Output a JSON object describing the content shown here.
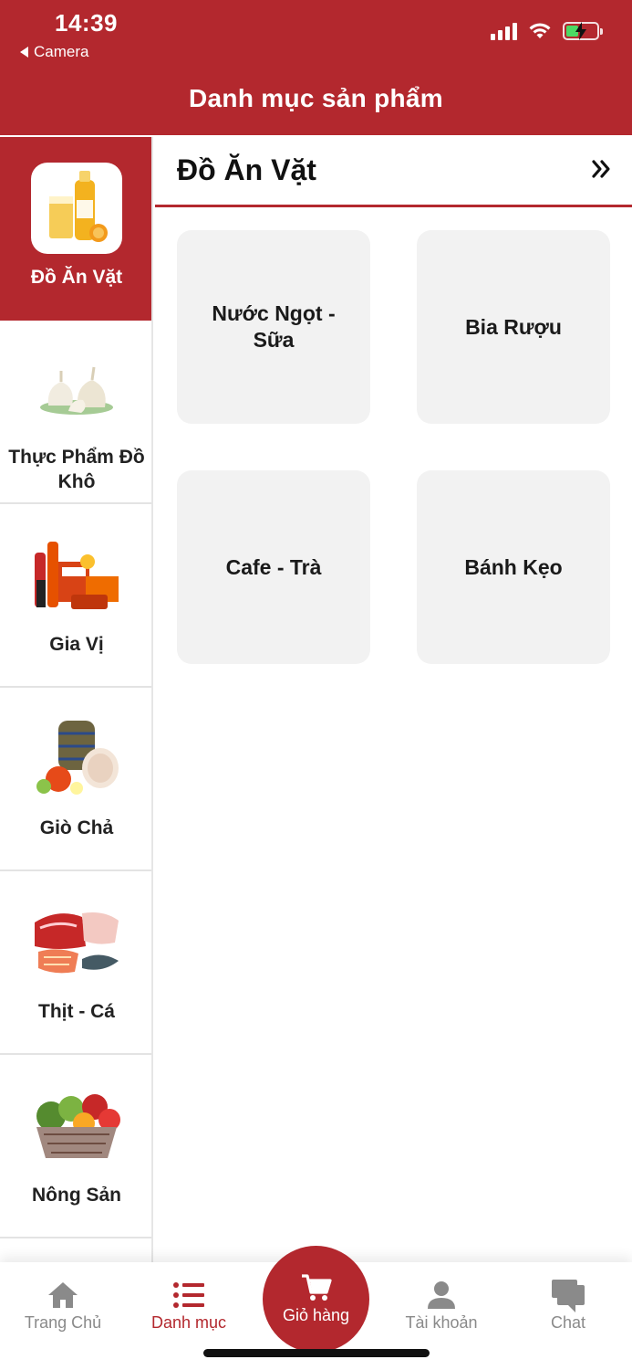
{
  "status_bar": {
    "time": "14:39",
    "back_label": "Camera"
  },
  "header": {
    "title": "Danh mục sản phẩm"
  },
  "sidebar": {
    "items": [
      {
        "label": "Đồ Ăn Vặt",
        "active": true,
        "icon": "juice-bottle-image"
      },
      {
        "label": "Thực Phẩm Đồ Khô",
        "active": false,
        "icon": "garlic-image"
      },
      {
        "label": "Gia Vị",
        "active": false,
        "icon": "spices-image"
      },
      {
        "label": "Giò Chả",
        "active": false,
        "icon": "pork-roll-image"
      },
      {
        "label": "Thịt - Cá",
        "active": false,
        "icon": "meat-fish-image"
      },
      {
        "label": "Nông Sản",
        "active": false,
        "icon": "vegetables-basket-image"
      }
    ]
  },
  "main": {
    "section_title": "Đồ Ăn Vặt",
    "more_icon": "double-chevron-right-icon",
    "subcategories": [
      {
        "label": "Nước Ngọt - Sữa"
      },
      {
        "label": "Bia Rượu"
      },
      {
        "label": "Cafe - Trà"
      },
      {
        "label": "Bánh Kẹo"
      }
    ]
  },
  "tabbar": {
    "tabs": [
      {
        "label": "Trang Chủ",
        "icon": "home-icon",
        "active": false
      },
      {
        "label": "Danh mục",
        "icon": "list-icon",
        "active": true
      },
      {
        "label": "Giỏ hàng",
        "icon": "cart-icon",
        "active": false
      },
      {
        "label": "Tài khoản",
        "icon": "user-icon",
        "active": false
      },
      {
        "label": "Chat",
        "icon": "chat-icon",
        "active": false
      }
    ]
  },
  "colors": {
    "brand": "#b3282e",
    "tile_bg": "#f2f2f2",
    "inactive_tab": "#8a8a8a"
  }
}
